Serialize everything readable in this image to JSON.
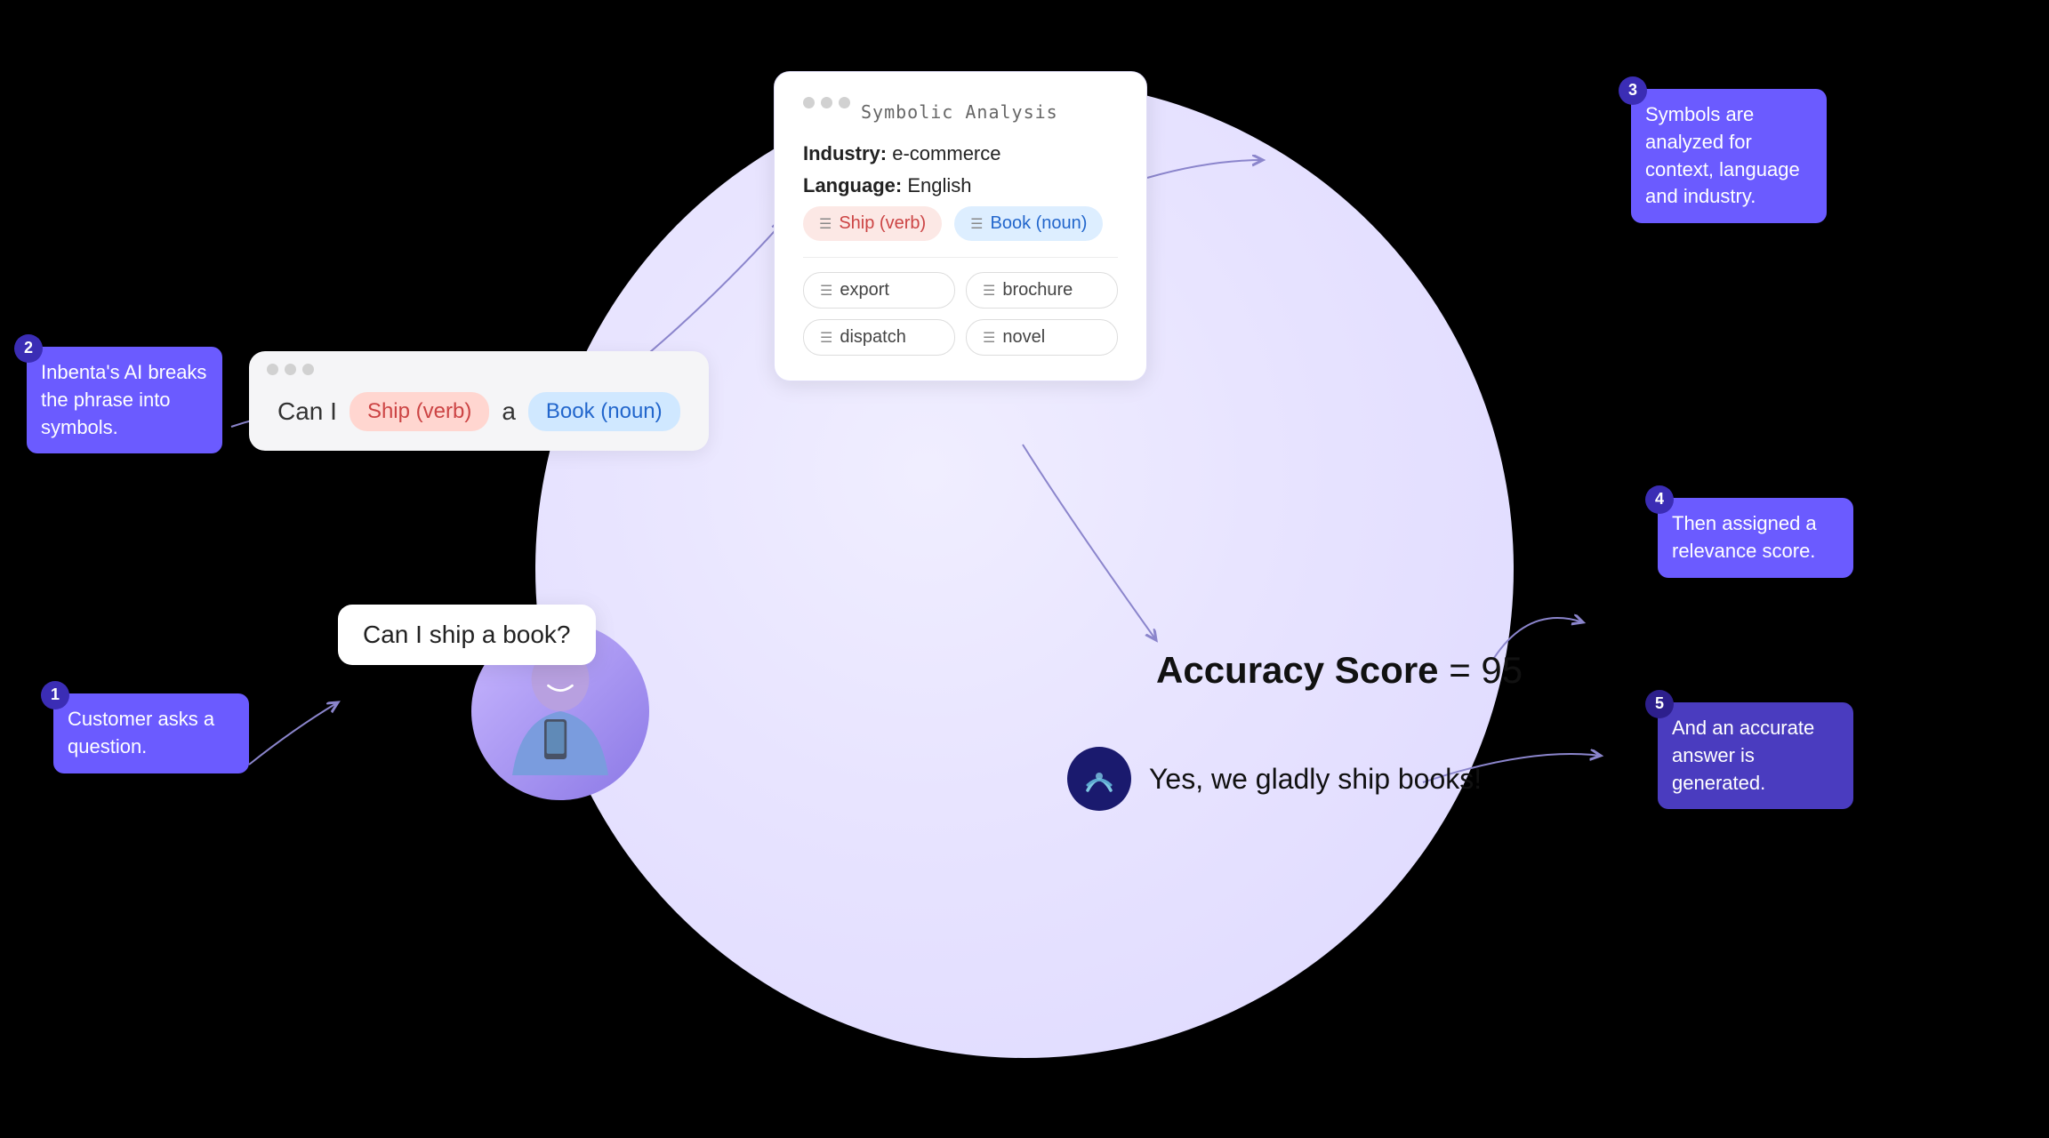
{
  "scene": {
    "background": "#000000"
  },
  "steps": [
    {
      "number": "1",
      "text": "Customer asks a question.",
      "variant": "purple"
    },
    {
      "number": "2",
      "text": "Inbenta's AI breaks the phrase into symbols.",
      "variant": "purple"
    },
    {
      "number": "3",
      "text": "Symbols are analyzed for context, language and industry.",
      "variant": "purple"
    },
    {
      "number": "4",
      "text": "Then assigned a relevance score.",
      "variant": "purple"
    },
    {
      "number": "5",
      "text": "And an accurate answer is generated.",
      "variant": "dark-purple"
    }
  ],
  "chat": {
    "question": "Can I ship a book?"
  },
  "phrase_card": {
    "word1": "Can  I",
    "tag1_label": "Ship (verb)",
    "tag1_variant": "pink",
    "word2": "a",
    "tag2_label": "Book (noun)",
    "tag2_variant": "blue"
  },
  "symbolic_analysis": {
    "window_title": "Symbolic Analysis",
    "industry_label": "Industry:",
    "industry_value": "e-commerce",
    "language_label": "Language:",
    "language_value": "English",
    "tag1_label": "Ship (verb)",
    "tag1_variant": "pink",
    "tag2_label": "Book (noun)",
    "tag2_variant": "blue",
    "gray_tags": [
      "export",
      "brochure",
      "dispatch",
      "novel"
    ]
  },
  "accuracy": {
    "label_bold": "Accuracy Score",
    "label_eq": " = 95"
  },
  "response": {
    "text": "Yes, we gladly ship books!"
  }
}
